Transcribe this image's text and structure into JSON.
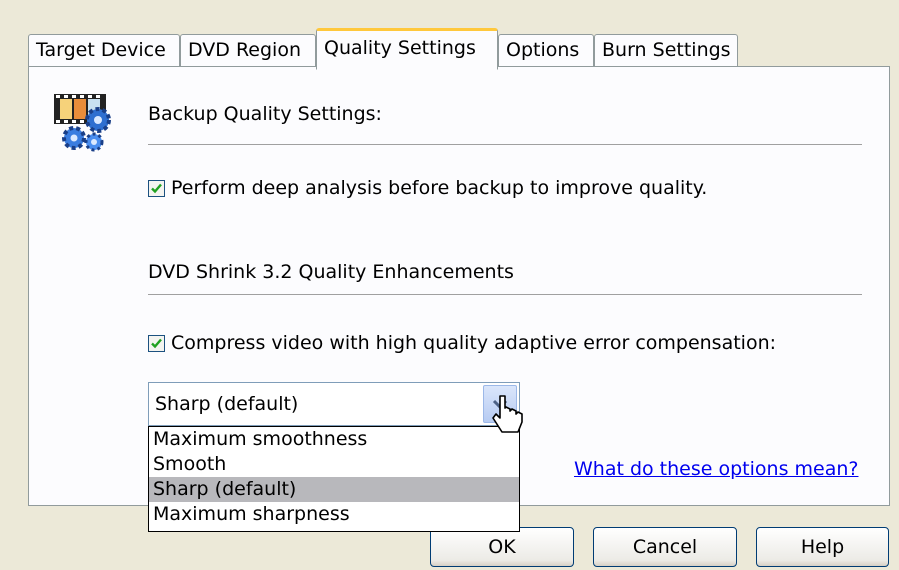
{
  "tabs": [
    {
      "label": "Target Device"
    },
    {
      "label": "DVD Region"
    },
    {
      "label": "Quality Settings"
    },
    {
      "label": "Options"
    },
    {
      "label": "Burn Settings"
    }
  ],
  "backup": {
    "heading": "Backup Quality Settings:",
    "deep_analysis_label": "Perform deep analysis before backup to improve quality.",
    "deep_analysis_checked": true
  },
  "enhancements": {
    "heading": "DVD Shrink 3.2 Quality Enhancements",
    "compress_label": "Compress video with high quality adaptive error compensation:",
    "compress_checked": true
  },
  "quality_select": {
    "value": "Sharp (default)",
    "options": [
      "Maximum smoothness",
      "Smooth",
      "Sharp (default)",
      "Maximum sharpness"
    ],
    "highlighted_index": 2
  },
  "help_link": "What do these options mean?",
  "buttons": {
    "ok": "OK",
    "cancel": "Cancel",
    "help": "Help"
  },
  "colors": {
    "tab_accent": "#ffc83c",
    "check_green": "#21a121",
    "link": "#0000ee"
  }
}
